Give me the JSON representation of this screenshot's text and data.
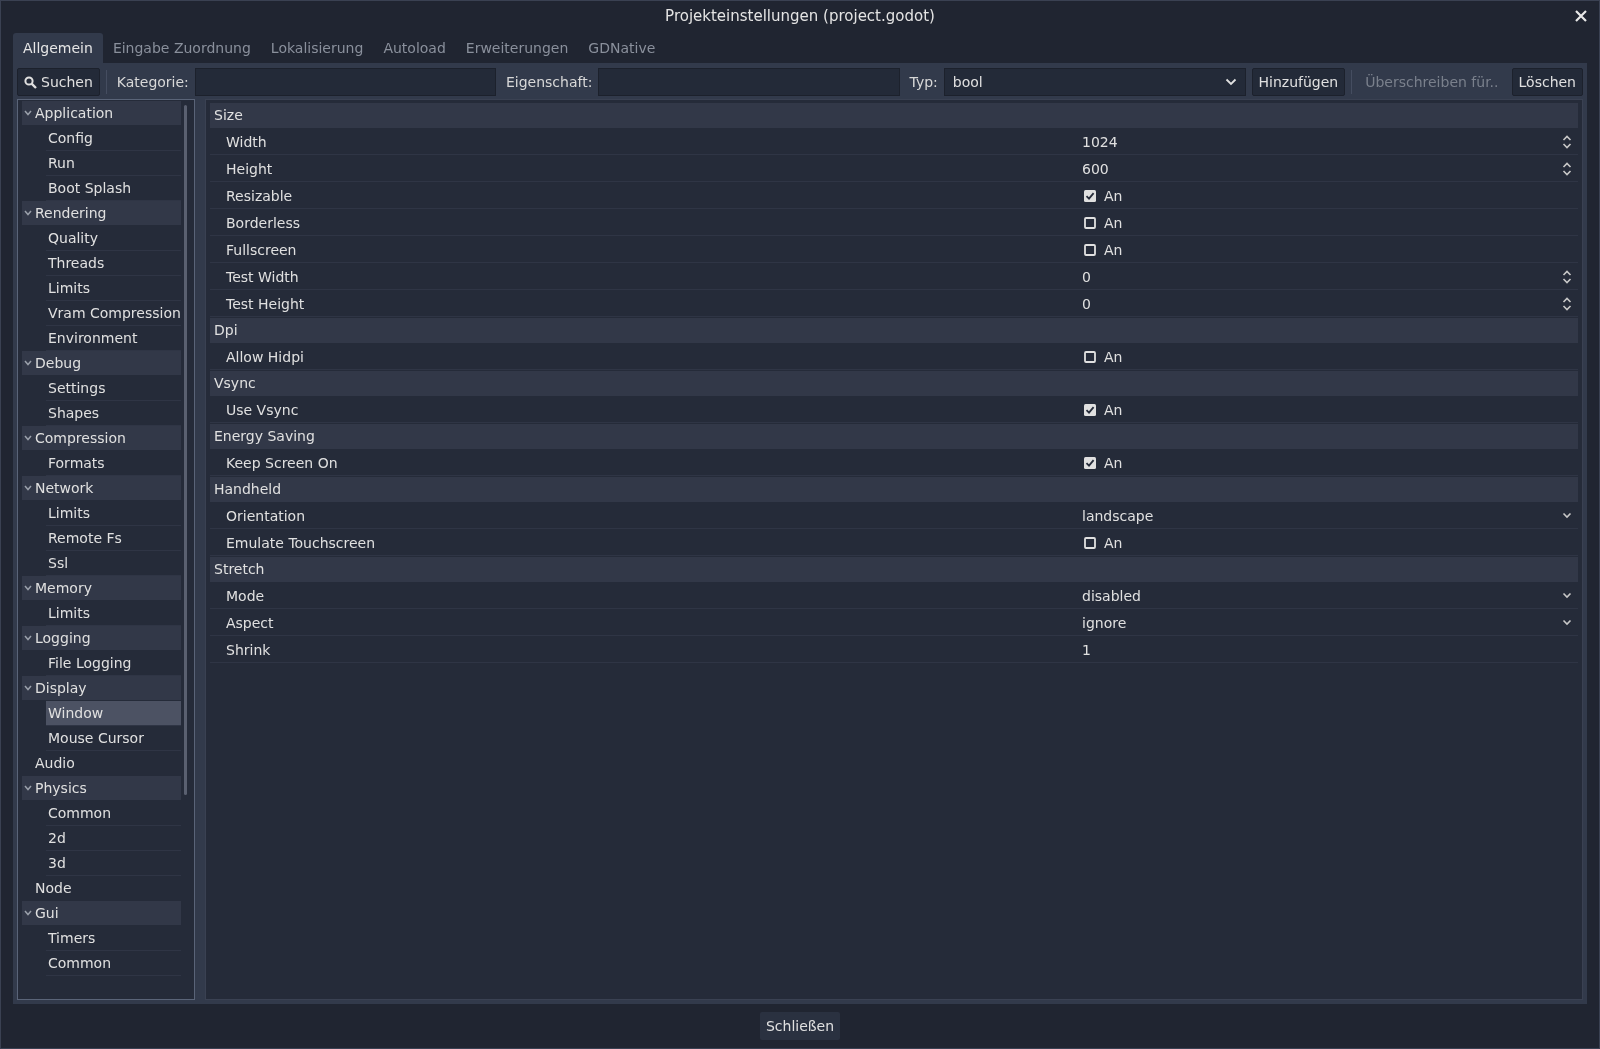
{
  "window": {
    "title": "Projekteinstellungen (project.godot)"
  },
  "tabs": [
    {
      "label": "Allgemein",
      "selected": true
    },
    {
      "label": "Eingabe Zuordnung",
      "selected": false
    },
    {
      "label": "Lokalisierung",
      "selected": false
    },
    {
      "label": "Autoload",
      "selected": false
    },
    {
      "label": "Erweiterungen",
      "selected": false
    },
    {
      "label": "GDNative",
      "selected": false
    }
  ],
  "toolbar": {
    "search_button": "Suchen",
    "category_label": "Kategorie:",
    "property_label": "Eigenschaft:",
    "type_label": "Typ:",
    "type_value": "bool",
    "add_button": "Hinzufügen",
    "override_button": {
      "label": "Überschreiben für..",
      "disabled": true
    },
    "delete_button": "Löschen"
  },
  "sidebar": {
    "items": [
      {
        "label": "Application",
        "expanded": true,
        "selected": false,
        "children": [
          {
            "label": "Config",
            "selected": false
          },
          {
            "label": "Run",
            "selected": false
          },
          {
            "label": "Boot Splash",
            "selected": false
          }
        ]
      },
      {
        "label": "Rendering",
        "expanded": true,
        "selected": false,
        "children": [
          {
            "label": "Quality",
            "selected": false
          },
          {
            "label": "Threads",
            "selected": false
          },
          {
            "label": "Limits",
            "selected": false
          },
          {
            "label": "Vram Compression",
            "selected": false
          },
          {
            "label": "Environment",
            "selected": false
          }
        ]
      },
      {
        "label": "Debug",
        "expanded": true,
        "selected": false,
        "children": [
          {
            "label": "Settings",
            "selected": false
          },
          {
            "label": "Shapes",
            "selected": false
          }
        ]
      },
      {
        "label": "Compression",
        "expanded": true,
        "selected": false,
        "children": [
          {
            "label": "Formats",
            "selected": false
          }
        ]
      },
      {
        "label": "Network",
        "expanded": true,
        "selected": false,
        "children": [
          {
            "label": "Limits",
            "selected": false
          },
          {
            "label": "Remote Fs",
            "selected": false
          },
          {
            "label": "Ssl",
            "selected": false
          }
        ]
      },
      {
        "label": "Memory",
        "expanded": true,
        "selected": false,
        "children": [
          {
            "label": "Limits",
            "selected": false
          }
        ]
      },
      {
        "label": "Logging",
        "expanded": true,
        "selected": false,
        "children": [
          {
            "label": "File Logging",
            "selected": false
          }
        ]
      },
      {
        "label": "Display",
        "expanded": true,
        "selected": false,
        "children": [
          {
            "label": "Window",
            "selected": true
          },
          {
            "label": "Mouse Cursor",
            "selected": false
          }
        ]
      },
      {
        "label": "Audio",
        "expanded": false,
        "selected": false
      },
      {
        "label": "Physics",
        "expanded": true,
        "selected": false,
        "children": [
          {
            "label": "Common",
            "selected": false
          },
          {
            "label": "2d",
            "selected": false
          },
          {
            "label": "3d",
            "selected": false
          }
        ]
      },
      {
        "label": "Node",
        "expanded": false,
        "selected": false
      },
      {
        "label": "Gui",
        "expanded": true,
        "selected": false,
        "children": [
          {
            "label": "Timers",
            "selected": false
          },
          {
            "label": "Common",
            "selected": false
          }
        ]
      }
    ]
  },
  "sections": [
    {
      "title": "Size",
      "properties": [
        {
          "label": "Width",
          "kind": "number",
          "value": "1024"
        },
        {
          "label": "Height",
          "kind": "number",
          "value": "600"
        },
        {
          "label": "Resizable",
          "kind": "check",
          "value": "An",
          "checked": true
        },
        {
          "label": "Borderless",
          "kind": "check",
          "value": "An",
          "checked": false
        },
        {
          "label": "Fullscreen",
          "kind": "check",
          "value": "An",
          "checked": false
        },
        {
          "label": "Test Width",
          "kind": "number",
          "value": "0"
        },
        {
          "label": "Test Height",
          "kind": "number",
          "value": "0"
        }
      ]
    },
    {
      "title": "Dpi",
      "properties": [
        {
          "label": "Allow Hidpi",
          "kind": "check",
          "value": "An",
          "checked": false
        }
      ]
    },
    {
      "title": "Vsync",
      "properties": [
        {
          "label": "Use Vsync",
          "kind": "check",
          "value": "An",
          "checked": true
        }
      ]
    },
    {
      "title": "Energy Saving",
      "properties": [
        {
          "label": "Keep Screen On",
          "kind": "check",
          "value": "An",
          "checked": true
        }
      ]
    },
    {
      "title": "Handheld",
      "properties": [
        {
          "label": "Orientation",
          "kind": "enum",
          "value": "landscape"
        },
        {
          "label": "Emulate Touchscreen",
          "kind": "check",
          "value": "An",
          "checked": false
        }
      ]
    },
    {
      "title": "Stretch",
      "properties": [
        {
          "label": "Mode",
          "kind": "enum",
          "value": "disabled"
        },
        {
          "label": "Aspect",
          "kind": "enum",
          "value": "ignore"
        },
        {
          "label": "Shrink",
          "kind": "text",
          "value": "1"
        }
      ]
    }
  ],
  "footer": {
    "close_button": "Schließen"
  }
}
